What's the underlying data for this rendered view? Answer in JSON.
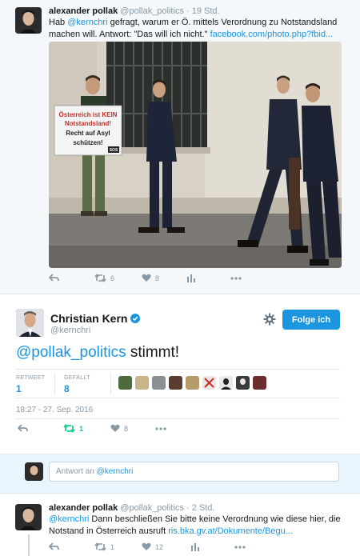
{
  "tweet1": {
    "name": "alexander pollak",
    "handle": "@pollak_politics",
    "time": "19 Std.",
    "text_line1_pre": "Hab ",
    "text_mention": "@kernchri",
    "text_line1_post": " gefragt, warum er Ö. mittels Verordnung zu Notstandsland",
    "text_line2_pre": "machen will. Antwort: \"Das will ich nicht.\" ",
    "text_link": "facebook.com/photo.php?fbid...",
    "sign_line1": "Österreich ist KEIN",
    "sign_line2": "Notstandsland!",
    "sign_line3": "Recht auf Asyl",
    "sign_line4": "schützen!",
    "sign_badge": "SOS",
    "retweets": "6",
    "likes": "8"
  },
  "focused": {
    "name": "Christian Kern",
    "handle": "@kernchri",
    "follow_label": "Folge ich",
    "text_mention": "@pollak_politics",
    "text_rest": " stimmt!",
    "retweet_label": "RETWEET",
    "retweet_count": "1",
    "like_label": "GEFÄLLT",
    "like_count": "8",
    "date": "18:27 - 27. Sep. 2016",
    "action_retweets": "1",
    "action_likes": "8"
  },
  "reply": {
    "placeholder_prefix": "Antwort an ",
    "placeholder_mention": "@kernchri"
  },
  "tweet2": {
    "name": "alexander pollak",
    "handle": "@pollak_politics",
    "time": "2 Std.",
    "text_mention": "@kernchri",
    "text_line1_post": " Dann beschließen Sie bitte keine Verordnung wie diese hier, die",
    "text_line2_pre": "Notstand in Österreich ausruft ",
    "text_link": "ris.bka.gv.at/Dokumente/Begu...",
    "retweets": "1",
    "likes": "12"
  },
  "colors": {
    "accent": "#1b95e0",
    "retweet_active": "#19cf86",
    "muted": "#8899a6"
  }
}
